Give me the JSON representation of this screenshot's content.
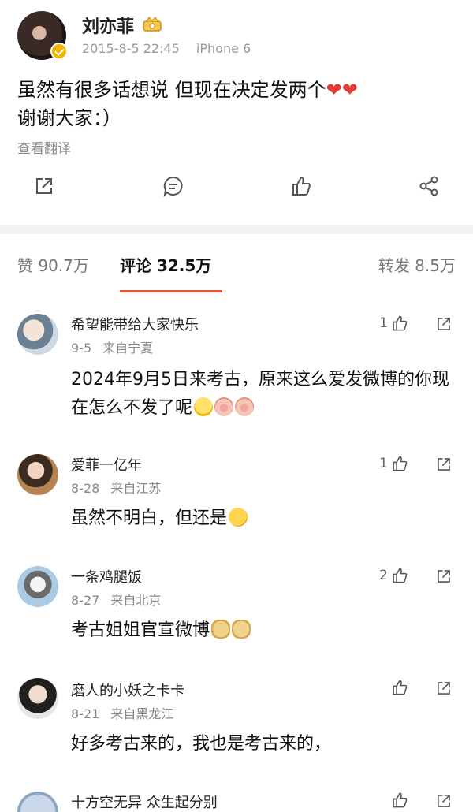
{
  "post": {
    "author": "刘亦菲",
    "timestamp": "2015-8-5 22:45",
    "device": "iPhone 6",
    "text_before": "虽然有很多话想说 但现在决定发两个",
    "text_after": "谢谢大家：）",
    "hearts": "❤❤",
    "translate_label": "查看翻译"
  },
  "tabs": {
    "likes": "赞 90.7万",
    "comments": "评论 32.5万",
    "reposts": "转发 8.5万"
  },
  "comments": [
    {
      "name": "希望能带给大家快乐",
      "date": "9-5",
      "location": "来自宁夏",
      "likes": "1",
      "text": "2024年9月5日来考古，原来这么爱发微博的你现在怎么不发了呢"
    },
    {
      "name": "爱菲一亿年",
      "date": "8-28",
      "location": "来自江苏",
      "likes": "1",
      "text": "虽然不明白，但还是"
    },
    {
      "name": "一条鸡腿饭",
      "date": "8-27",
      "location": "来自北京",
      "likes": "2",
      "text": "考古姐姐官宣微博"
    },
    {
      "name": "磨人的小妖之卡卡",
      "date": "8-21",
      "location": "来自黑龙江",
      "likes": "",
      "text": "好多考古来的，我也是考古来的，"
    },
    {
      "name": "十方空无异 众生起分别",
      "date": "",
      "location": "",
      "likes": "",
      "text": ""
    }
  ],
  "colors": {
    "accent": "#e8542e",
    "verify": "#f5b400",
    "heart": "#e53935"
  }
}
